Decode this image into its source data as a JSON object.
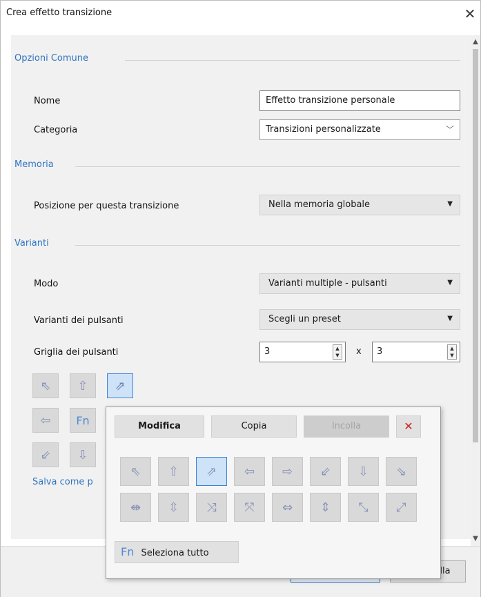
{
  "window": {
    "title": "Crea effetto transizione",
    "close_glyph": "✕"
  },
  "sections": {
    "common": "Opzioni Comune",
    "memory": "Memoria",
    "variants": "Varianti"
  },
  "fields": {
    "name_label": "Nome",
    "name_value": "Effetto transizione personale",
    "category_label": "Categoria",
    "category_value": "Transizioni personalizzate",
    "position_label": "Posizione per questa transizione",
    "position_value": "Nella memoria globale",
    "mode_label": "Modo",
    "mode_value": "Varianti multiple - pulsanti",
    "button_variants_label": "Varianti dei pulsanti",
    "button_variants_value": "Scegli un preset",
    "grid_label": "Griglia dei pulsanti",
    "grid_cols": "3",
    "grid_times": "x",
    "grid_rows": "3"
  },
  "grid_buttons": [
    {
      "icon": "arrow-up-left-icon",
      "glyph": "⇖"
    },
    {
      "icon": "arrow-up-icon",
      "glyph": "⇧"
    },
    {
      "icon": "arrow-up-right-icon",
      "glyph": "⇗",
      "selected": true
    },
    {
      "icon": "arrow-left-icon",
      "glyph": "⇦"
    },
    {
      "icon": "fn-icon",
      "glyph": "Fn"
    },
    {
      "icon": "arrow-down-left-icon",
      "glyph": "⇙"
    },
    {
      "icon": "arrow-down-icon",
      "glyph": "⇩"
    }
  ],
  "save_link": "Salva come p",
  "popup": {
    "edit": "Modifica",
    "copy": "Copia",
    "paste": "Incolla",
    "delete_glyph": "✕",
    "select_all_fn": "Fn",
    "select_all": "Seleziona tutto",
    "row1": [
      "⇖",
      "⇧",
      "⇗",
      "⇦",
      "⇨",
      "⇙",
      "⇩",
      "⇘"
    ],
    "row2": [
      "⇼",
      "⇳",
      "⤨",
      "⤧",
      "⇔",
      "⇕",
      "⤡",
      "⤢"
    ]
  },
  "footer": {
    "cancel_partial": "lla"
  },
  "colors": {
    "accent": "#2f74c1",
    "selected_border": "#3b82d6",
    "delete": "#d21f1f"
  }
}
